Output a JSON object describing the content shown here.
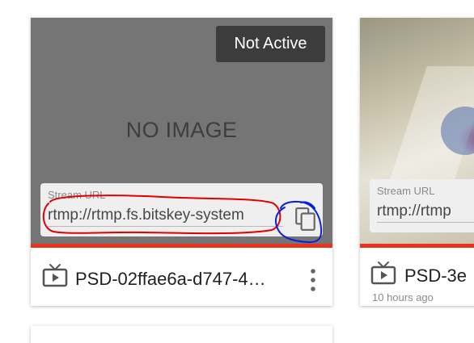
{
  "cards": [
    {
      "status_badge": "Not Active",
      "placeholder_text": "NO IMAGE",
      "stream_label": "Stream URL",
      "stream_url": "rtmp://rtmp.fs.bitskey-system",
      "device_name": "PSD-02ffae6a-d747-4…",
      "icon": "tv-icon",
      "menu_icon": "more-vert-icon"
    },
    {
      "stream_label": "Stream URL",
      "stream_url": "rtmp://rtmp",
      "device_name": "PSD-3e",
      "time_ago": "10 hours ago",
      "icon": "tv-icon"
    }
  ],
  "colors": {
    "accent_bar": "#e8341c",
    "annotation_red": "#e00000",
    "annotation_blue": "#0a1ee0"
  }
}
